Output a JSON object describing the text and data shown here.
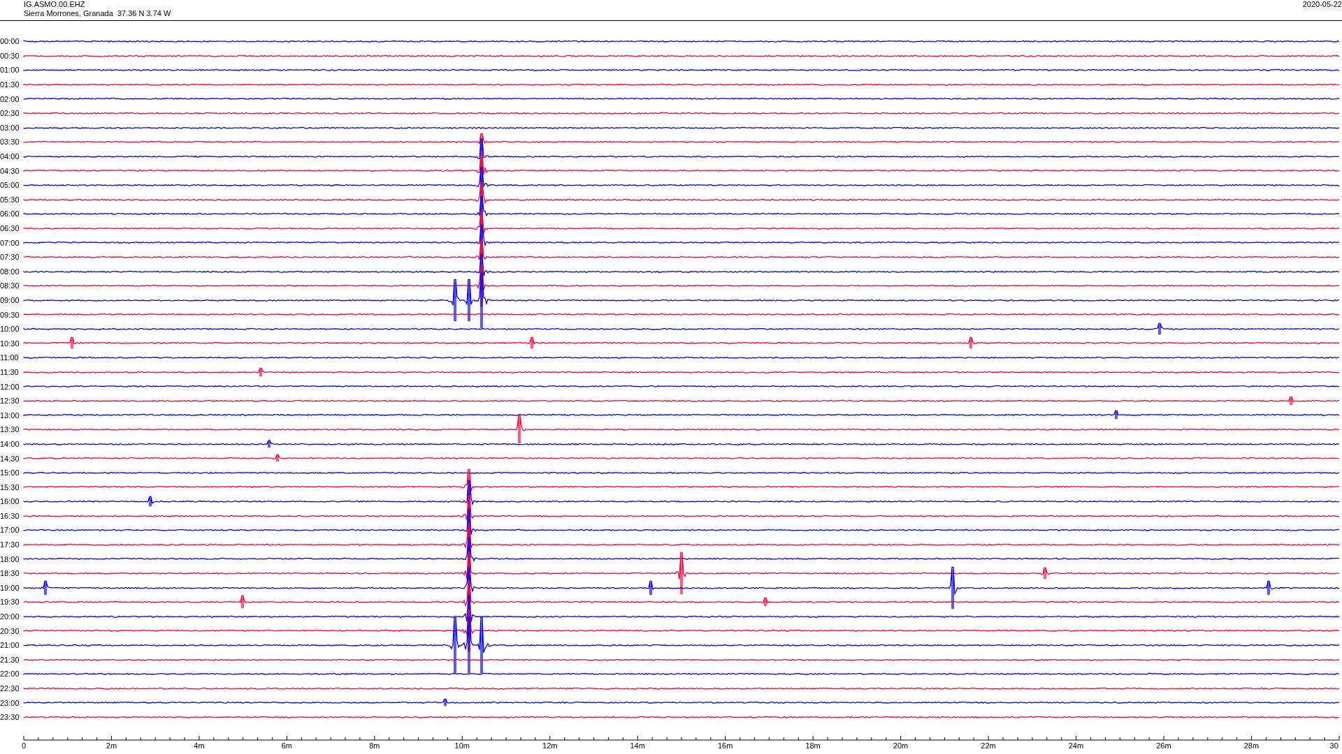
{
  "header": {
    "station": "IG.ASMO.00.EHZ",
    "location": "Sierra Morrones, Granada  37.36 N 3.74 W",
    "date": "2020-05-22"
  },
  "rows": [
    {
      "time": "00:00",
      "color": "#0000ff"
    },
    {
      "time": "00:30",
      "color": "#ff0033"
    },
    {
      "time": "01:00",
      "color": "#0000ff"
    },
    {
      "time": "01:30",
      "color": "#ff0033"
    },
    {
      "time": "02:00",
      "color": "#0000ff"
    },
    {
      "time": "02:30",
      "color": "#ff0033"
    },
    {
      "time": "03:00",
      "color": "#0000ff"
    },
    {
      "time": "03:30",
      "color": "#ff0033"
    },
    {
      "time": "04:00",
      "color": "#0000ff"
    },
    {
      "time": "04:30",
      "color": "#ff0033"
    },
    {
      "time": "05:00",
      "color": "#0000ff"
    },
    {
      "time": "05:30",
      "color": "#ff0033"
    },
    {
      "time": "06:00",
      "color": "#0000ff"
    },
    {
      "time": "06:30",
      "color": "#ff0033"
    },
    {
      "time": "07:00",
      "color": "#0000ff"
    },
    {
      "time": "07:30",
      "color": "#ff0033"
    },
    {
      "time": "08:00",
      "color": "#0000ff"
    },
    {
      "time": "08:30",
      "color": "#ff0033"
    },
    {
      "time": "09:00",
      "color": "#0000ff"
    },
    {
      "time": "09:30",
      "color": "#ff0033"
    },
    {
      "time": "10:00",
      "color": "#0000ff"
    },
    {
      "time": "10:30",
      "color": "#ff0033"
    },
    {
      "time": "11:00",
      "color": "#0000ff"
    },
    {
      "time": "11:30",
      "color": "#ff0033"
    },
    {
      "time": "12:00",
      "color": "#0000ff"
    },
    {
      "time": "12:30",
      "color": "#ff0033"
    },
    {
      "time": "13:00",
      "color": "#0000ff"
    },
    {
      "time": "13:30",
      "color": "#ff0033"
    },
    {
      "time": "14:00",
      "color": "#0000ff"
    },
    {
      "time": "14:30",
      "color": "#ff0033"
    },
    {
      "time": "15:00",
      "color": "#0000ff"
    },
    {
      "time": "15:30",
      "color": "#ff0033"
    },
    {
      "time": "16:00",
      "color": "#0000ff"
    },
    {
      "time": "16:30",
      "color": "#ff0033"
    },
    {
      "time": "17:00",
      "color": "#0000ff"
    },
    {
      "time": "17:30",
      "color": "#ff0033"
    },
    {
      "time": "18:00",
      "color": "#0000ff"
    },
    {
      "time": "18:30",
      "color": "#ff0033"
    },
    {
      "time": "19:00",
      "color": "#0000ff"
    },
    {
      "time": "19:30",
      "color": "#ff0033"
    },
    {
      "time": "20:00",
      "color": "#0000ff"
    },
    {
      "time": "20:30",
      "color": "#ff0033"
    },
    {
      "time": "21:00",
      "color": "#0000ff"
    },
    {
      "time": "21:30",
      "color": "#ff0033"
    },
    {
      "time": "22:00",
      "color": "#0000ff"
    },
    {
      "time": "22:30",
      "color": "#ff0033"
    },
    {
      "time": "23:00",
      "color": "#0000ff"
    },
    {
      "time": "23:30",
      "color": "#ff0033"
    }
  ],
  "x_axis": {
    "labels": [
      "0",
      "2m",
      "4m",
      "6m",
      "8m",
      "10m",
      "12m",
      "14m",
      "16m",
      "18m",
      "20m",
      "22m",
      "24m",
      "26m",
      "28m",
      "30"
    ]
  }
}
